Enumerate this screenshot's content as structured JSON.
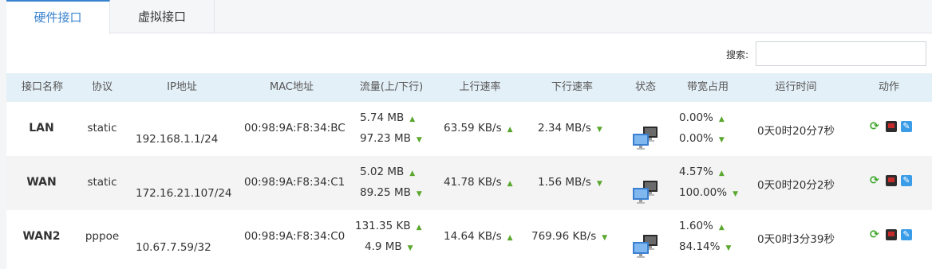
{
  "tabs": [
    {
      "label": "硬件接口",
      "active": true
    },
    {
      "label": "虚拟接口",
      "active": false
    }
  ],
  "search": {
    "label": "搜索:",
    "placeholder": "",
    "value": ""
  },
  "table": {
    "columns": [
      "接口名称",
      "协议",
      "IP地址",
      "MAC地址",
      "流量(上/下行)",
      "上行速率",
      "下行速率",
      "状态",
      "带宽占用",
      "运行时间",
      "动作"
    ],
    "rows": [
      {
        "name": "LAN",
        "protocol": "static",
        "ip": "192.168.1.1/24",
        "mac": "00:98:9A:F8:34:BC",
        "traffic_up": "5.74 MB",
        "traffic_down": "97.23 MB",
        "up_rate": "63.59 KB/s",
        "down_rate": "2.34 MB/s",
        "bw_up": "0.00%",
        "bw_down": "0.00%",
        "uptime": "0天0时20分7秒"
      },
      {
        "name": "WAN",
        "protocol": "static",
        "ip": "172.16.21.107/24",
        "mac": "00:98:9A:F8:34:C1",
        "traffic_up": "5.02 MB",
        "traffic_down": "89.25 MB",
        "up_rate": "41.78 KB/s",
        "down_rate": "1.56 MB/s",
        "bw_up": "4.57%",
        "bw_down": "100.00%",
        "uptime": "0天0时20分2秒"
      },
      {
        "name": "WAN2",
        "protocol": "pppoe",
        "ip": "10.67.7.59/32",
        "mac": "00:98:9A:F8:34:C0",
        "traffic_up": "131.35 KB",
        "traffic_down": "4.9 MB",
        "up_rate": "14.64 KB/s",
        "down_rate": "769.96 KB/s",
        "bw_up": "1.60%",
        "bw_down": "84.14%",
        "uptime": "0天0时3分39秒"
      }
    ]
  },
  "icons": {
    "up_arrow": "arrow-up-icon",
    "down_arrow": "arrow-down-icon",
    "status": "network-computers-icon",
    "refresh": "refresh-icon",
    "monitor": "monitor-icon",
    "edit": "edit-icon"
  },
  "colors": {
    "accent": "#3a83cf",
    "arrow": "#5aa72e",
    "header_bg": "#e4f0f8"
  }
}
